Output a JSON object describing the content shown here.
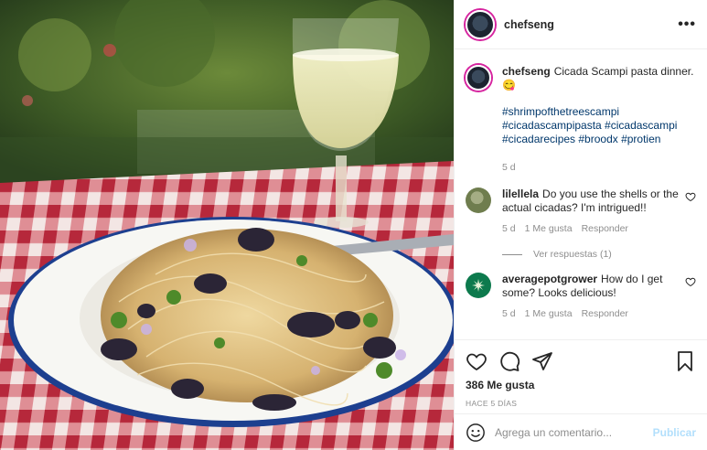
{
  "post": {
    "username": "chefseng",
    "more_icon": "more-horizontal-icon"
  },
  "caption": {
    "username": "chefseng",
    "text": "Cicada Scampi pasta dinner.",
    "emoji": "😋",
    "hashtags_line1": "#shrimpofthetreescampi",
    "hashtags_line2": "#cicadascampipasta #cicadascampi",
    "hashtags_line3": "#cicadarecipes #broodx #protien",
    "age": "5 d"
  },
  "comments": [
    {
      "username": "lilellela",
      "text": "Do you use the shells or the actual cicadas? I'm intrigued!!",
      "age": "5 d",
      "likes": "1 Me gusta",
      "reply_label": "Responder",
      "avatar_color": "#6f7d4e"
    },
    {
      "username": "averagepotgrower",
      "text": "How do I get some? Looks delicious!",
      "age": "5 d",
      "likes": "1 Me gusta",
      "reply_label": "Responder",
      "avatar_color": "#0d7a4d"
    }
  ],
  "view_replies_label": "Ver respuestas (1)",
  "actions": {
    "icons": [
      "heart-icon",
      "comment-icon",
      "share-icon",
      "bookmark-icon"
    ],
    "likes_count": "386 Me gusta",
    "time_ago": "HACE 5 DÍAS"
  },
  "add_comment": {
    "placeholder": "Agrega un comentario...",
    "publish_label": "Publicar"
  },
  "colors": {
    "link": "#00376b",
    "muted": "#8e8e8e",
    "publish_disabled": "#b2dffc",
    "tablecloth_red": "#c8384a"
  }
}
